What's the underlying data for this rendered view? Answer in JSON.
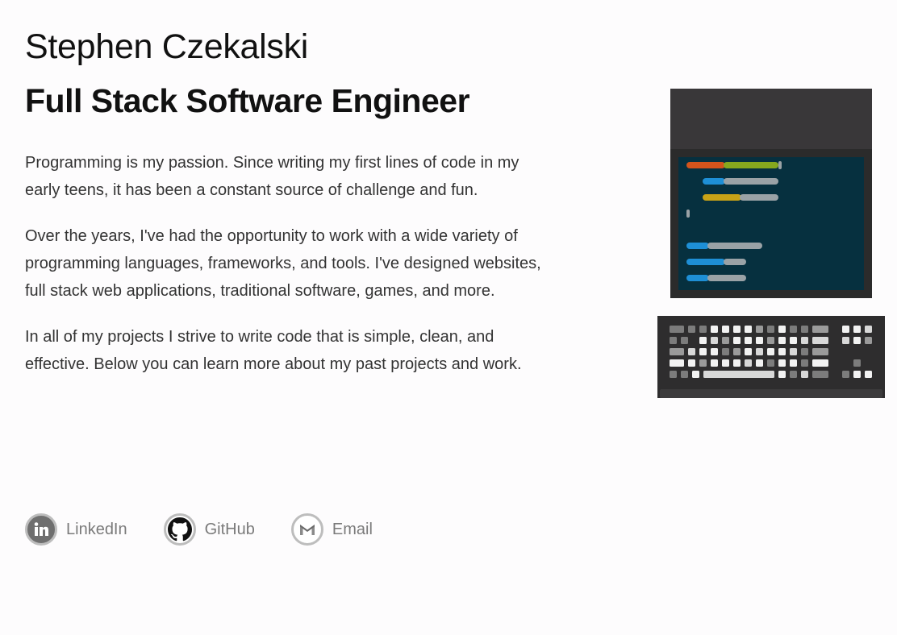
{
  "header": {
    "name": "Stephen Czekalski",
    "role": "Full Stack Software Engineer"
  },
  "bio": {
    "paragraphs": [
      "Programming is my passion. Since writing my first lines of code in my early teens, it has been a constant source of challenge and fun.",
      "Over the years, I've had the opportunity to work with a wide variety of programming languages, frameworks, and tools. I've designed websites, full stack web applications, traditional software, games, and more.",
      "In all of my projects I strive to write code that is simple, clean, and effective. Below you can learn more about my past projects and work."
    ]
  },
  "links": [
    {
      "label": "LinkedIn",
      "icon": "linkedin-icon"
    },
    {
      "label": "GitHub",
      "icon": "github-icon"
    },
    {
      "label": "Email",
      "icon": "gmail-icon"
    }
  ],
  "illustration": {
    "monitor_icon": "code-editor-illustration",
    "keyboard_icon": "keyboard-illustration",
    "colors": {
      "orange": "#d3541c",
      "green": "#86a81e",
      "blue": "#1e8fd6",
      "yellow": "#c8a216",
      "gray": "#9aa2a6",
      "screen": "#06303f"
    }
  }
}
